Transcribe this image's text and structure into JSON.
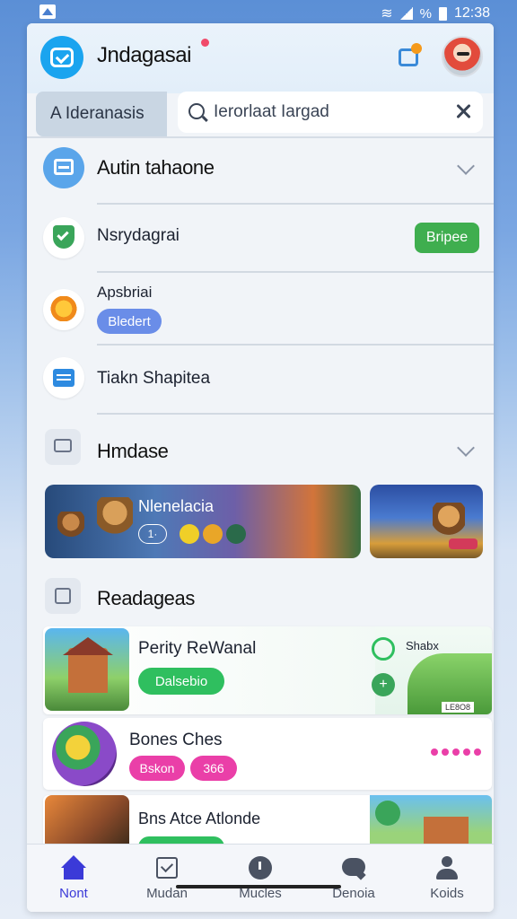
{
  "status": {
    "battery_text": "%",
    "time": "12:38"
  },
  "header": {
    "title": "Jndagasai"
  },
  "search": {
    "tab_label": "A Ideranasis",
    "placeholder": "Ierorlaat Iargad"
  },
  "sections": {
    "auto": {
      "title": "Autin tahaone"
    },
    "list": [
      {
        "label": "Nsrydagrai",
        "badge": "Bripee",
        "badge_color": "#3fae4f"
      },
      {
        "label": "Apsbriai",
        "badge": "Bledert",
        "badge_color": "#6a8de8"
      },
      {
        "label": "Tiakn Shapitea"
      }
    ],
    "hmd": {
      "title": "Hmdase"
    },
    "banner": {
      "title": "Nlenelacia",
      "chip": "1·"
    },
    "readages": {
      "title": "Readageas"
    }
  },
  "cards": [
    {
      "title": "Perity ReWanal",
      "button": "Dalsebio",
      "side_label": "Shabx",
      "tag": "LE8O8",
      "accent": "#2fbf5f"
    },
    {
      "title": "Bones Ches",
      "button": "Bskon",
      "button2": "366",
      "accent": "#ea3fa8"
    },
    {
      "title": "Bns Atce Atlonde",
      "accent": "#2fbf5f"
    }
  ],
  "nav": [
    {
      "label": "Nont",
      "icon": "home-icon",
      "active": true
    },
    {
      "label": "Mudan",
      "icon": "inbox-icon"
    },
    {
      "label": "Mucles",
      "icon": "clock-icon"
    },
    {
      "label": "Denoia",
      "icon": "chat-icon"
    },
    {
      "label": "Koids",
      "icon": "profile-icon"
    }
  ],
  "colors": {
    "primary": "#1aa4ef",
    "nav_active": "#3b3ad8",
    "green": "#3fae4f"
  }
}
